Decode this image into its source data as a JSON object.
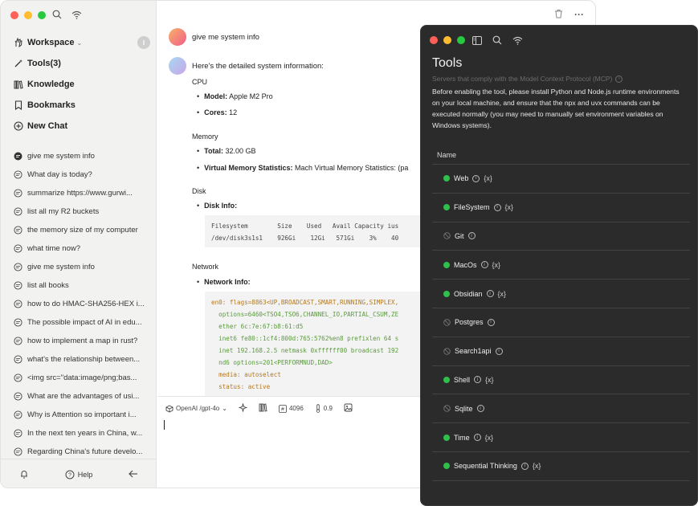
{
  "sidebar": {
    "nav": [
      {
        "label": "Workspace",
        "icon": "hand-icon",
        "badge": "I"
      },
      {
        "label": "Tools(3)",
        "icon": "magic-wand-icon"
      },
      {
        "label": "Knowledge",
        "icon": "books-icon"
      },
      {
        "label": "Bookmarks",
        "icon": "bookmark-icon"
      },
      {
        "label": "New Chat",
        "icon": "plus-circle-icon"
      }
    ],
    "history": [
      "give me system info",
      "What day is today?",
      "summarize https://www.gurwi...",
      "list all my R2 buckets",
      "the memory size of my computer",
      "what time now?",
      "give me system info",
      "list all books",
      "how to do HMAC-SHA256-HEX i...",
      "The possible impact of AI in edu...",
      "how to implement a map in rust?",
      "what's the relationship between...",
      "<img src=\"data:image/png;bas...",
      "What are the advantages of usi...",
      "Why is Attention so important i...",
      "In the next ten years in China, w...",
      "Regarding China's future develo..."
    ],
    "footer": {
      "help_label": "Help"
    }
  },
  "chat": {
    "user_message": "give me system info",
    "bot_intro": "Here's the detailed system information:",
    "cpu": {
      "heading": "CPU",
      "model_label": "Model:",
      "model_value": " Apple M2 Pro",
      "cores_label": "Cores:",
      "cores_value": " 12"
    },
    "memory": {
      "heading": "Memory",
      "total_label": "Total:",
      "total_value": " 32.00 GB",
      "vm_label": "Virtual Memory Statistics:",
      "vm_value": " Mach Virtual Memory Statistics: (pa"
    },
    "disk": {
      "heading": "Disk",
      "info_label": "Disk Info:",
      "code_line1": "Filesystem        Size    Used   Avail Capacity ius",
      "code_line2": "/dev/disk3s1s1    926Gi    12Gi   571Gi    3%    40"
    },
    "network": {
      "heading": "Network",
      "info_label": "Network Info:",
      "code_lines": [
        "en0: flags=8863<UP,BROADCAST,SMART,RUNNING,SIMPLEX,",
        "  options=6460<TSO4,TSO6,CHANNEL_IO,PARTIAL_CSUM,ZE",
        "  ether 6c:7e:67:b8:61:d5",
        "  inet6 fe80::1cf4:800d:765:5762%en8 prefixlen 64 s",
        "  inet 192.168.2.5 netmask 0xffffff00 broadcast 192",
        "  nd6 options=201<PERFORMNUD,DAD>",
        "  media: autoselect",
        "  status: active"
      ]
    },
    "toolbar": {
      "model": "OpenAI /gpt-4o",
      "max_tokens": "4096",
      "temperature": "0.9"
    }
  },
  "tools_panel": {
    "title": "Tools",
    "subtitle": "Servers that comply with the Model Context Protocol (MCP)",
    "note": "Before enabling the tool, please install Python and Node.js runtime environments on your local machine, and ensure that the npx and uvx commands can be executed normally (you may need to manually set environment variables on Windows systems).",
    "column_name": "Name",
    "env_symbol": "{x}",
    "tools": [
      {
        "name": "Web",
        "enabled": true,
        "env": true
      },
      {
        "name": "FileSystem",
        "enabled": true,
        "env": true
      },
      {
        "name": "Git",
        "enabled": false,
        "env": false
      },
      {
        "name": "MacOs",
        "enabled": true,
        "env": true
      },
      {
        "name": "Obsidian",
        "enabled": true,
        "env": true
      },
      {
        "name": "Postgres",
        "enabled": false,
        "env": false
      },
      {
        "name": "Search1api",
        "enabled": false,
        "env": false
      },
      {
        "name": "Shell",
        "enabled": true,
        "env": true
      },
      {
        "name": "Sqlite",
        "enabled": false,
        "env": false
      },
      {
        "name": "Time",
        "enabled": true,
        "env": true
      },
      {
        "name": "Sequential Thinking",
        "enabled": true,
        "env": true
      }
    ]
  },
  "colors": {
    "enabled": "#2fbf4a",
    "panel_bg": "#2b2b2b",
    "sidebar_bg": "#f2f2f1"
  }
}
